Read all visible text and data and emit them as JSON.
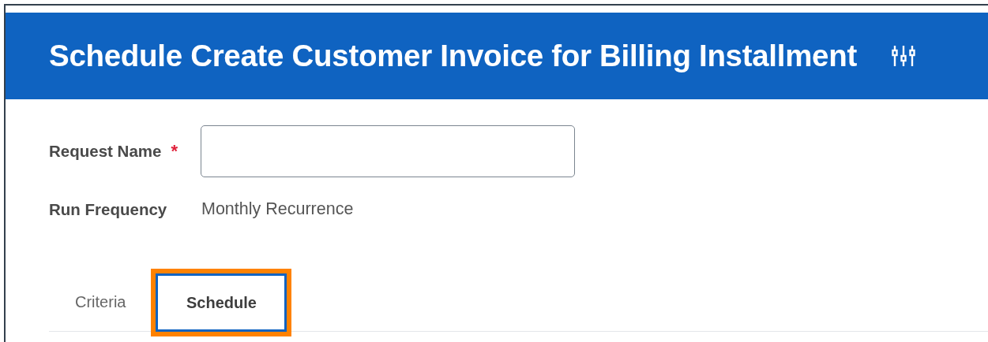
{
  "header": {
    "title": "Schedule Create Customer Invoice for Billing Installment"
  },
  "fields": [
    {
      "kind": "input",
      "label": "Request Name",
      "required": true,
      "required_mark": "*"
    },
    {
      "kind": "text",
      "label": "Run Frequency",
      "value": "Monthly Recurrence"
    }
  ],
  "tabs": [
    {
      "label": "Criteria",
      "selected": false,
      "highlighted": false
    },
    {
      "label": "Schedule",
      "selected": true,
      "highlighted": true
    }
  ]
}
